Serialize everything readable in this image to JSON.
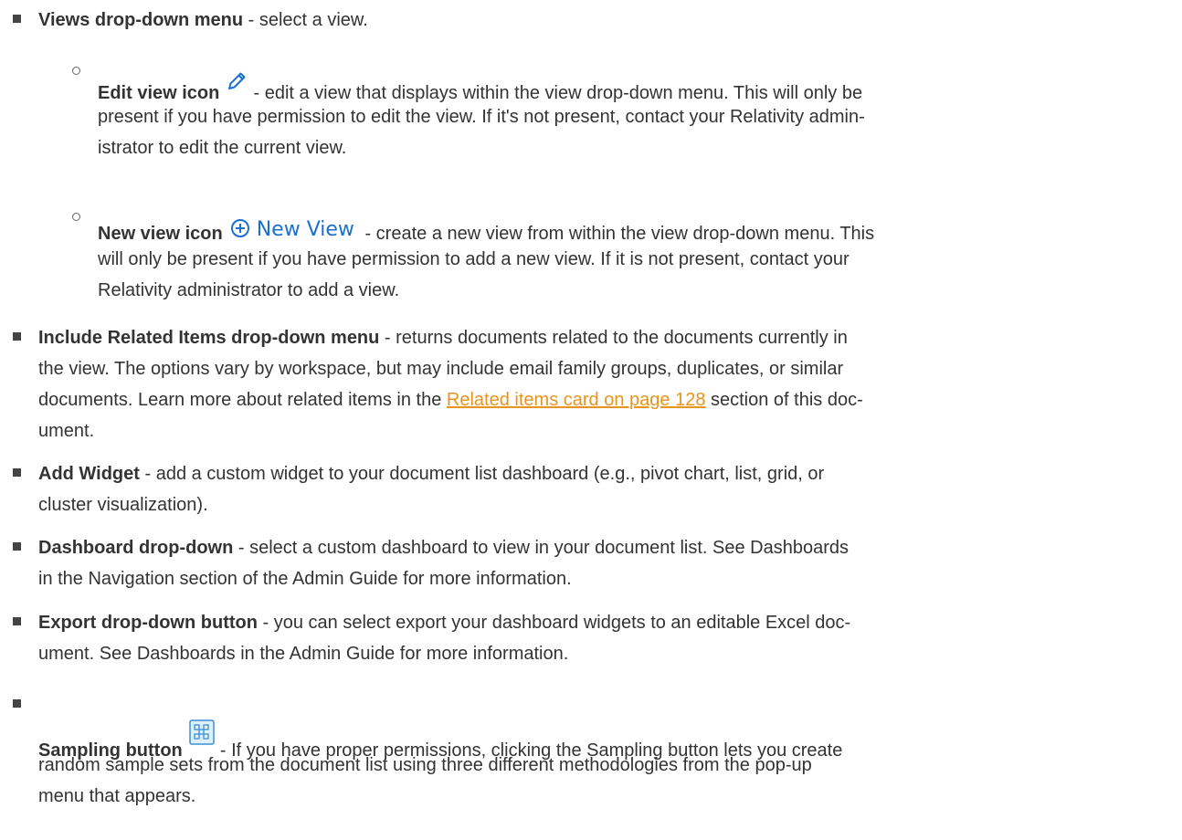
{
  "items": [
    {
      "term": "Views drop-down menu",
      "desc": " - select a view."
    },
    {
      "term": "Edit view icon",
      "desc_line1": " - edit a view that displays within the view drop-down menu. This will only be",
      "desc_line2": "present if you have permission to edit the view. If it's not present, contact your Relativity admin-",
      "desc_line3": "istrator to edit the current view.",
      "icon": "pencil-icon"
    },
    {
      "term": "New view icon",
      "icon_label": "New View",
      "icon": "plus-circle-icon",
      "desc_line1": " - create a new view from within the view drop-down menu. This",
      "desc_line2": "will only be present if you have permission to add a new view. If it is not present, contact your",
      "desc_line3": "Relativity administrator to add a view."
    },
    {
      "term": "Include Related Items drop-down menu",
      "desc_line1": " - returns documents related to the documents currently in",
      "desc_line2": "the view. The options vary by workspace, but may include email family groups, duplicates, or similar",
      "desc_line3a": "documents. Learn more about related items in the ",
      "link": "Related items card on page 128",
      "desc_line3b": " section of this doc-",
      "desc_line4": "ument."
    },
    {
      "term": "Add Widget",
      "desc_line1": " - add a custom widget to your document list dashboard (e.g., pivot chart, list, grid, or",
      "desc_line2": "cluster visualization)."
    },
    {
      "term": "Dashboard drop-down",
      "desc_line1": " - select a custom dashboard to view in your document list. See Dashboards",
      "desc_line2": "in the Navigation section of the Admin Guide for more information."
    },
    {
      "term": "Export drop-down button",
      "desc_line1": " - you can select export your dashboard widgets to an editable Excel doc-",
      "desc_line2": "ument. See Dashboards in the Admin Guide for more information."
    },
    {
      "term": "Sampling button",
      "icon": "sampling-icon",
      "desc_line1": " - If you have proper permissions, clicking the Sampling button lets you create",
      "desc_line2": "random sample sets from the document list using three different methodologies from the pop-up",
      "desc_line3": "menu that appears."
    }
  ],
  "colors": {
    "text": "#333333",
    "link": "#e8941e",
    "icon_blue": "#1a6fd1"
  }
}
